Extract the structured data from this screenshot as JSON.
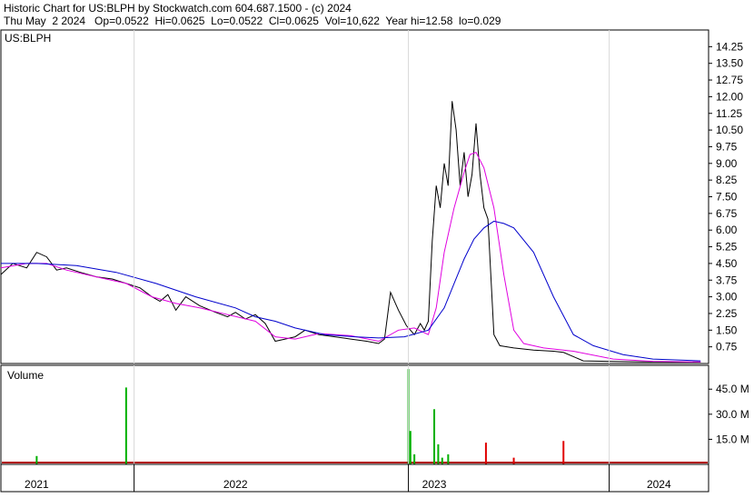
{
  "header": {
    "line1": "Historic Chart for US:BLPH by Stockwatch.com 604.687.1500 - (c) 2024",
    "line2": "Thu May  2 2024   Op=0.0522  Hi=0.0625  Lo=0.0522  Cl=0.0625  Vol=10,622  Year hi=12.58  lo=0.029"
  },
  "chart_data": [
    {
      "type": "line",
      "symbol_label": "US:BLPH",
      "ylim": [
        0,
        15
      ],
      "y_ticks": [
        "14.25",
        "13.50",
        "12.75",
        "12.00",
        "11.25",
        "10.50",
        "9.75",
        "9.00",
        "8.25",
        "7.50",
        "6.75",
        "6.00",
        "5.25",
        "4.50",
        "3.75",
        "3.00",
        "2.25",
        "1.50",
        "0.75"
      ],
      "x_range": [
        2020.82,
        2024.38
      ],
      "colors": {
        "price": "#000000",
        "ma_short": "#e000e0",
        "ma_long": "#0000cc"
      },
      "series": [
        {
          "x": [
            2020.82,
            2020.88,
            2020.95,
            2021.0,
            2021.05,
            2021.1,
            2021.15,
            2021.22,
            2021.3,
            2021.38,
            2021.45,
            2021.52,
            2021.58,
            2021.62,
            2021.66,
            2021.7,
            2021.75,
            2021.82,
            2021.9,
            2021.96,
            2022.0,
            2022.05,
            2022.1,
            2022.15,
            2022.2,
            2022.25,
            2022.3,
            2022.35,
            2022.42,
            2022.5,
            2022.58,
            2022.66,
            2022.72,
            2022.75,
            2022.78,
            2022.82,
            2022.86,
            2022.88,
            2022.9,
            2022.93,
            2022.95,
            2022.97,
            2022.99,
            2023.01,
            2023.03,
            2023.05,
            2023.07,
            2023.09,
            2023.11,
            2023.13,
            2023.15,
            2023.17,
            2023.19,
            2023.21,
            2023.23,
            2023.25,
            2023.27,
            2023.3,
            2023.33,
            2023.4,
            2023.5,
            2023.6,
            2023.65,
            2023.75,
            2023.9,
            2024.05,
            2024.2,
            2024.34
          ],
          "y": [
            4.0,
            4.5,
            4.3,
            5.0,
            4.8,
            4.2,
            4.3,
            4.1,
            3.9,
            3.8,
            3.6,
            3.4,
            3.0,
            2.8,
            3.1,
            2.4,
            3.0,
            2.6,
            2.3,
            2.1,
            2.3,
            2.0,
            2.2,
            1.8,
            1.0,
            1.1,
            1.2,
            1.5,
            1.3,
            1.2,
            1.1,
            1.0,
            0.9,
            1.1,
            3.2,
            2.4,
            1.7,
            1.5,
            1.3,
            1.8,
            1.5,
            1.9,
            5.5,
            8.0,
            7.0,
            9.0,
            8.0,
            11.8,
            10.5,
            8.0,
            9.5,
            7.5,
            8.5,
            10.8,
            8.5,
            7.0,
            6.5,
            1.3,
            0.8,
            0.7,
            0.6,
            0.55,
            0.5,
            0.12,
            0.09,
            0.07,
            0.06,
            0.06
          ]
        },
        {
          "x": [
            2020.82,
            2020.95,
            2021.05,
            2021.15,
            2021.3,
            2021.45,
            2021.58,
            2021.7,
            2021.82,
            2021.96,
            2022.1,
            2022.2,
            2022.3,
            2022.42,
            2022.58,
            2022.72,
            2022.82,
            2022.9,
            2022.97,
            2023.01,
            2023.05,
            2023.1,
            2023.15,
            2023.18,
            2023.21,
            2023.25,
            2023.3,
            2023.35,
            2023.4,
            2023.45,
            2023.55,
            2023.7,
            2023.9,
            2024.1,
            2024.34
          ],
          "y": [
            4.3,
            4.5,
            4.5,
            4.2,
            3.9,
            3.6,
            3.0,
            2.7,
            2.5,
            2.2,
            1.9,
            1.2,
            1.1,
            1.35,
            1.25,
            1.0,
            1.5,
            1.6,
            1.3,
            2.5,
            5.0,
            7.0,
            8.6,
            9.4,
            9.5,
            8.8,
            7.0,
            4.0,
            1.5,
            0.9,
            0.7,
            0.55,
            0.2,
            0.1,
            0.07
          ]
        },
        {
          "x": [
            2020.82,
            2021.0,
            2021.2,
            2021.4,
            2021.6,
            2021.8,
            2022.0,
            2022.1,
            2022.2,
            2022.3,
            2022.45,
            2022.6,
            2022.72,
            2022.85,
            2022.97,
            2023.05,
            2023.1,
            2023.15,
            2023.2,
            2023.25,
            2023.3,
            2023.35,
            2023.4,
            2023.5,
            2023.6,
            2023.7,
            2023.8,
            2023.95,
            2024.1,
            2024.34
          ],
          "y": [
            4.5,
            4.5,
            4.4,
            4.1,
            3.6,
            3.0,
            2.5,
            2.1,
            1.9,
            1.6,
            1.3,
            1.2,
            1.15,
            1.2,
            1.5,
            2.5,
            3.6,
            4.7,
            5.6,
            6.1,
            6.4,
            6.3,
            6.1,
            5.0,
            3.0,
            1.3,
            0.8,
            0.4,
            0.2,
            0.12
          ]
        }
      ]
    },
    {
      "type": "bar",
      "title": "Volume",
      "ylim": [
        0,
        56
      ],
      "y_ticks": [
        "45.0 M",
        "30.0 M",
        "15.0 M"
      ],
      "tick_values": [
        45,
        30,
        15
      ],
      "colors": {
        "up": "#00b000",
        "down": "#e00000"
      },
      "x": [
        2021.0,
        2021.45,
        2022.87,
        2022.88,
        2022.9,
        2023.0,
        2023.02,
        2023.04,
        2023.07,
        2023.26,
        2023.4,
        2023.65
      ],
      "values": [
        5,
        46,
        57,
        20,
        6,
        33,
        12,
        4,
        6,
        13,
        4,
        14
      ],
      "direction": [
        "up",
        "up",
        "up",
        "up",
        "up",
        "up",
        "up",
        "up",
        "up",
        "down",
        "down",
        "down"
      ]
    }
  ],
  "time_axis": {
    "labels": [
      "2021",
      "2022",
      "2023",
      "2024"
    ],
    "centers": [
      2021.0,
      2022.0,
      2023.0,
      2024.13
    ],
    "boundaries": [
      2021.49,
      2022.87,
      2023.88
    ]
  }
}
